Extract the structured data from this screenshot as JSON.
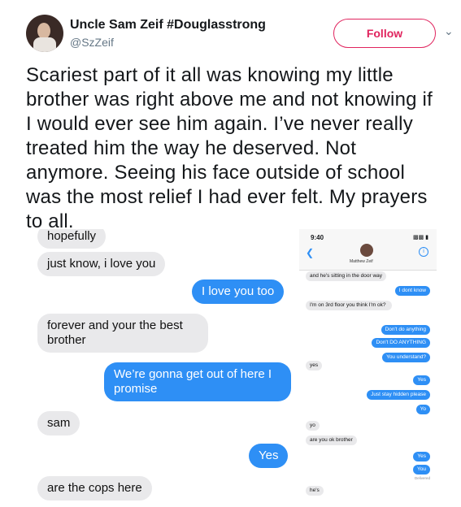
{
  "author": {
    "name": "Uncle Sam Zeif #Douglasstrong",
    "handle": "@SzZeif"
  },
  "follow_label": "Follow",
  "tweet_text": "Scariest part of it all was knowing my little brother was right above me and not knowing if I would ever see him again. I’ve never really treated him the way he deserved. Not anymore. Seeing his face outside of school was the most relief I had ever felt. My prayers to all.",
  "left_chat": [
    {
      "from": "them",
      "text": "hopefully"
    },
    {
      "from": "them",
      "text": "just know, i love you"
    },
    {
      "from": "me",
      "text": "I love you too"
    },
    {
      "from": "them",
      "text": "forever and your the best brother"
    },
    {
      "from": "me",
      "text": "We’re gonna get out of here I promise"
    },
    {
      "from": "them",
      "text": "sam"
    },
    {
      "from": "me",
      "text": "Yes"
    },
    {
      "from": "them",
      "text": "are the cops here"
    }
  ],
  "right_phone": {
    "time": "9:40",
    "contact": "Matthew Zeif",
    "messages": [
      {
        "from": "them",
        "text": "and he's sitting in the door way"
      },
      {
        "from": "me",
        "text": "I dont know"
      },
      {
        "from": "them",
        "text": "I'm on 3rd floor you think I'm ok?"
      },
      {
        "from": "me",
        "text": "Don't do anything"
      },
      {
        "from": "me",
        "text": "Don't DO ANYTHING"
      },
      {
        "from": "me",
        "text": "You understand?"
      },
      {
        "from": "them",
        "text": "yes"
      },
      {
        "from": "me",
        "text": "Yes"
      },
      {
        "from": "me",
        "text": "Just stay hidden please"
      },
      {
        "from": "me",
        "text": "Yo"
      },
      {
        "from": "them",
        "text": "yo"
      },
      {
        "from": "them",
        "text": "are you ok brother"
      },
      {
        "from": "me",
        "text": "Yes"
      },
      {
        "from": "me",
        "text": "You"
      },
      {
        "from": "them",
        "text": "he's"
      }
    ],
    "delivered": "Delivered"
  }
}
